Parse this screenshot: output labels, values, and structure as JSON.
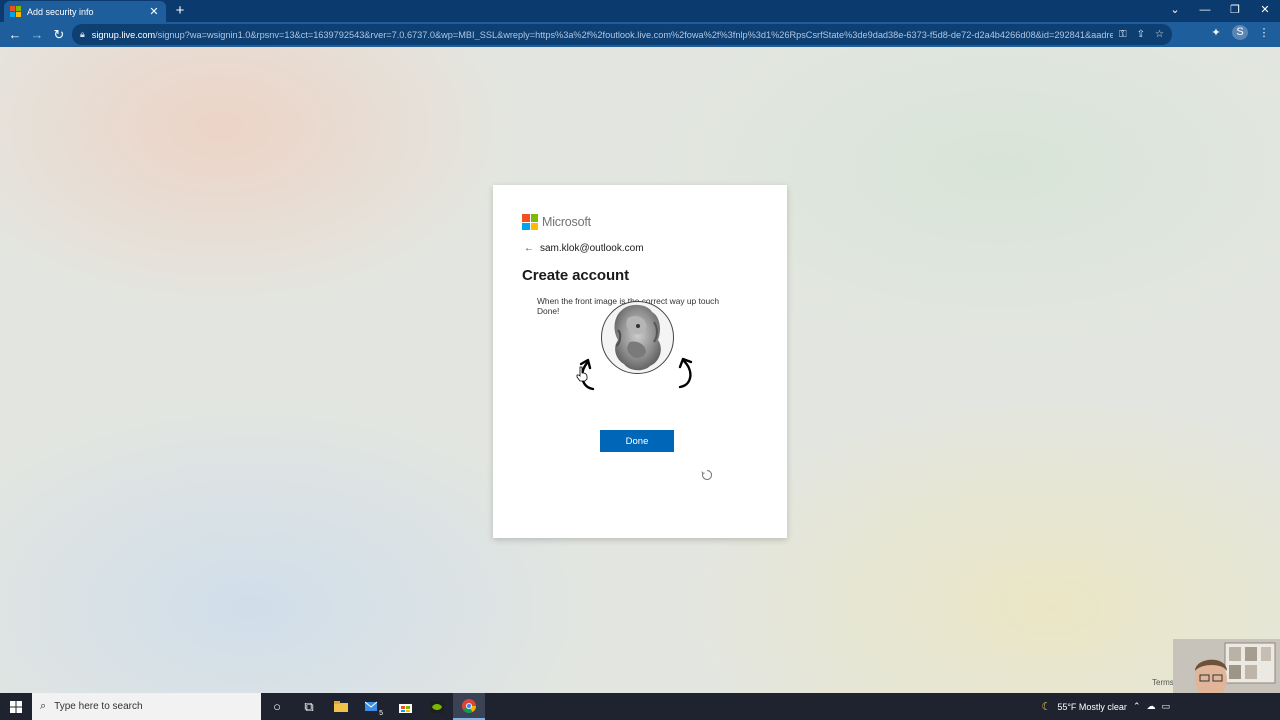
{
  "browser": {
    "tab_title": "Add security info",
    "tab_close": "✕",
    "new_tab": "+",
    "url_host": "signup.live.com",
    "url_rest": "/signup?wa=wsignin1.0&rpsnv=13&ct=1639792543&rver=7.0.6737.0&wp=MBI_SSL&wreply=https%3a%2f%2foutlook.live.com%2fowa%2f%3fnlp%3d1%26RpsCsrfState%3de9dad38e-6373-f5d8-de72-d2a4b4266d08&id=292841&aadre...",
    "profile_initial": "S"
  },
  "card": {
    "brand": "Microsoft",
    "back_arrow": "←",
    "identity": "sam.klok@outlook.com",
    "title": "Create account",
    "instructions": "When the front image is the correct way up touch Done!",
    "done_label": "Done"
  },
  "footer": {
    "terms": "Terms"
  },
  "taskbar": {
    "search_placeholder": "Type here to search",
    "mail_badge": "5",
    "weather": "55°F  Mostly clear"
  },
  "colors": {
    "primary_button": "#0067b8",
    "browser_frame": "#1f5e9c",
    "taskbar": "#1f2330"
  }
}
